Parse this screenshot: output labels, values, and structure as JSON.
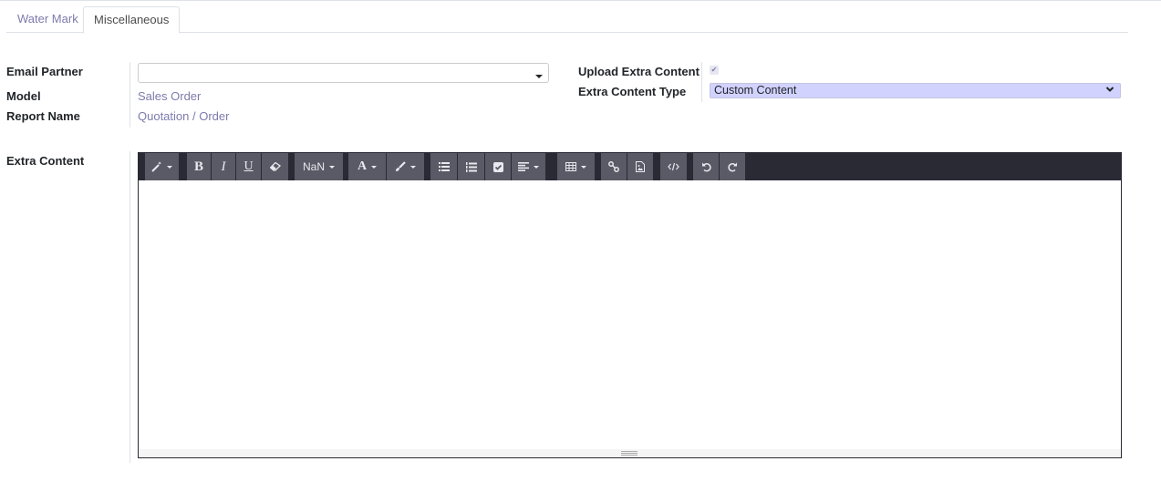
{
  "tabs": [
    {
      "label": "Water Mark",
      "active": false
    },
    {
      "label": "Miscellaneous",
      "active": true
    }
  ],
  "form": {
    "email_partner": {
      "label": "Email Partner",
      "value": ""
    },
    "model": {
      "label": "Model",
      "value": "Sales Order"
    },
    "report_name": {
      "label": "Report Name",
      "value": "Quotation / Order"
    },
    "upload_extra_content": {
      "label": "Upload Extra Content",
      "checked": true
    },
    "extra_content_type": {
      "label": "Extra Content Type",
      "value": "Custom Content"
    },
    "extra_content": {
      "label": "Extra Content",
      "value": ""
    }
  },
  "editor": {
    "font_size_label": "NaN",
    "bold_label": "B",
    "italic_label": "I",
    "underline_label": "U",
    "color_label": "A",
    "toolbar_icons": [
      "magic-wand-icon",
      "bold-icon",
      "italic-icon",
      "underline-icon",
      "eraser-icon",
      "font-size-dropdown",
      "font-color-icon",
      "highlight-brush-icon",
      "bullet-list-icon",
      "numbered-list-icon",
      "checklist-icon",
      "align-icon",
      "table-icon",
      "link-icon",
      "image-icon",
      "code-view-icon",
      "undo-icon",
      "redo-icon"
    ]
  },
  "colors": {
    "accent": "#7c7bad",
    "toolbar_bg": "#2a2a35",
    "toolbar_button": "#5a5a66",
    "select_bg": "#d2d2ff"
  }
}
